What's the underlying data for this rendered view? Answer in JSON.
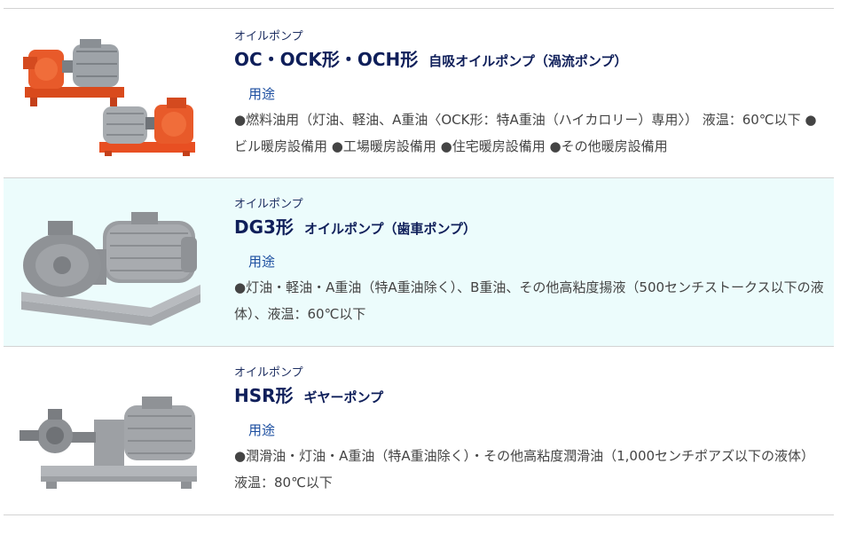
{
  "products": [
    {
      "category": "オイルポンプ",
      "model": "OC・OCK形・OCH形",
      "subtitle": "自吸オイルポンプ（渦流ポンプ）",
      "use_label": "用途",
      "desc": "●燃料油用（灯油、軽油、A重油〈OCK形：特A重油（ハイカロリー）専用〉） 液温：60℃以下 ●ビル暖房設備用 ●工場暖房設備用 ●住宅暖房設備用 ●その他暖房設備用",
      "colors": {
        "pump": "#e85a2a",
        "motor": "#9ea3a8",
        "base": "#e84f22"
      }
    },
    {
      "category": "オイルポンプ",
      "model": "DG3形",
      "subtitle": "オイルポンプ（歯車ポンプ）",
      "use_label": "用途",
      "desc": "●灯油・軽油・A重油（特A重油除く）、B重油、その他高粘度揚液（500センチストークス以下の液体）、液温：60℃以下",
      "colors": {
        "pump": "#8f9296",
        "motor": "#9a9da1",
        "base": "#a6a9ad"
      }
    },
    {
      "category": "オイルポンプ",
      "model": "HSR形",
      "subtitle": "ギヤーポンプ",
      "use_label": "用途",
      "desc": "●潤滑油・灯油・A重油（特A重油除く）・その他高粘度潤滑油（1,000センチポアズ以下の液体）液温：80℃以下",
      "colors": {
        "pump": "#8d9094",
        "motor": "#a3a6aa",
        "base": "#b3b6ba"
      }
    }
  ],
  "theme": {
    "title": "#0f1f5a",
    "use_label": "#1d4fa0",
    "body_text": "#444444",
    "alt_row": "#ecfcfc",
    "divider": "#d3d3d3"
  }
}
